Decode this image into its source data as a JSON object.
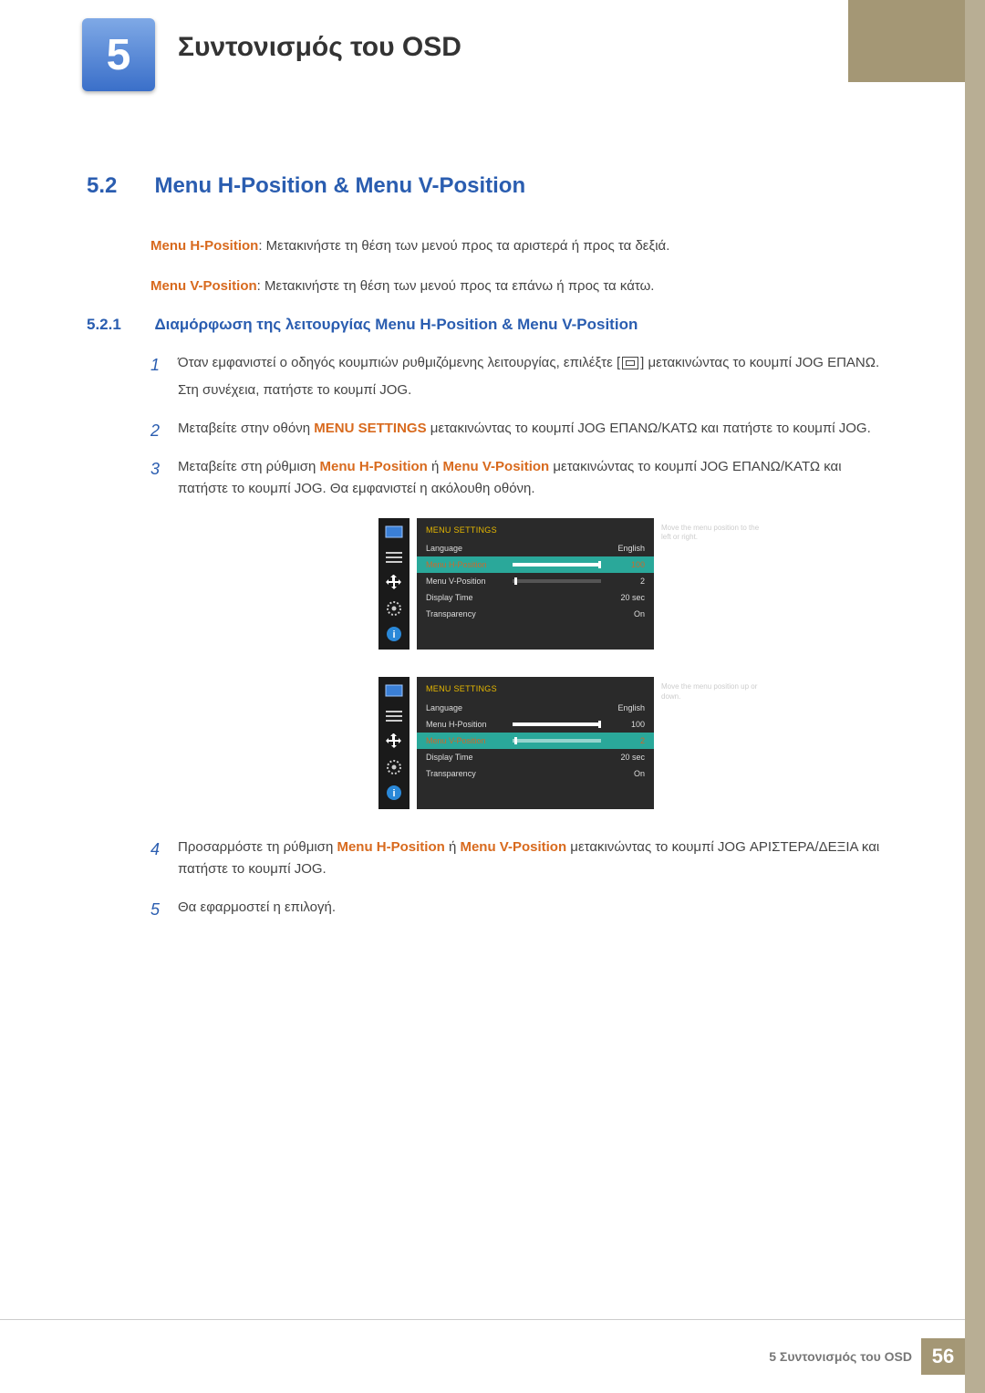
{
  "chapter": {
    "number": "5",
    "title": "Συντονισμός του OSD"
  },
  "section": {
    "number": "5.2",
    "title": "Menu H-Position & Menu V-Position"
  },
  "intro": {
    "hpos_label": "Menu H-Position",
    "hpos_text": ": Μετακινήστε τη θέση των μενού προς τα αριστερά ή προς τα δεξιά.",
    "vpos_label": "Menu V-Position",
    "vpos_text": ": Μετακινήστε τη θέση των μενού προς τα επάνω ή προς τα κάτω."
  },
  "subsection": {
    "number": "5.2.1",
    "title": "Διαμόρφωση της λειτουργίας Menu H-Position & Menu V-Position"
  },
  "steps": {
    "s1a": "Όταν εμφανιστεί ο οδηγός κουμπιών ρυθμιζόμενης λειτουργίας, επιλέξτε [",
    "s1b": "] μετακινώντας το κουμπί JOG ΕΠΑΝΩ.",
    "s1c": "Στη συνέχεια, πατήστε το κουμπί JOG.",
    "s2a": "Μεταβείτε στην οθόνη ",
    "s2_bold": "MENU SETTINGS",
    "s2b": " μετακινώντας το κουμπί JOG ΕΠΑΝΩ/ΚΑΤΩ και πατήστε το κουμπί JOG.",
    "s3a": "Μεταβείτε στη ρύθμιση ",
    "s3_h": "Menu H-Position",
    "s3_or": " ή ",
    "s3_v": "Menu V-Position",
    "s3b": " μετακινώντας το κουμπί JOG ΕΠΑΝΩ/ΚΑΤΩ και πατήστε το κουμπί JOG. Θα εμφανιστεί η ακόλουθη οθόνη.",
    "s4a": "Προσαρμόστε τη ρύθμιση ",
    "s4_h": "Menu H-Position",
    "s4_or": " ή ",
    "s4_v": "Menu V-Position",
    "s4b": " μετακινώντας το κουμπί JOG ΑΡΙΣΤΕΡΑ/ΔΕΞΙΑ και πατήστε το κουμπί JOG.",
    "s5": "Θα εφαρμοστεί η επιλογή."
  },
  "osd": {
    "header": "MENU SETTINGS",
    "rows": {
      "language": {
        "label": "Language",
        "value": "English"
      },
      "hpos": {
        "label": "Menu H-Position",
        "value": "100",
        "fill": 100
      },
      "vpos": {
        "label": "Menu V-Position",
        "value": "2",
        "fill": 2
      },
      "displaytime": {
        "label": "Display Time",
        "value": "20 sec"
      },
      "transparency": {
        "label": "Transparency",
        "value": "On"
      }
    },
    "tip1": "Move the menu position to the left or right.",
    "tip2": "Move the menu position up or down."
  },
  "footer": {
    "text": "5 Συντονισμός του OSD",
    "page": "56"
  }
}
